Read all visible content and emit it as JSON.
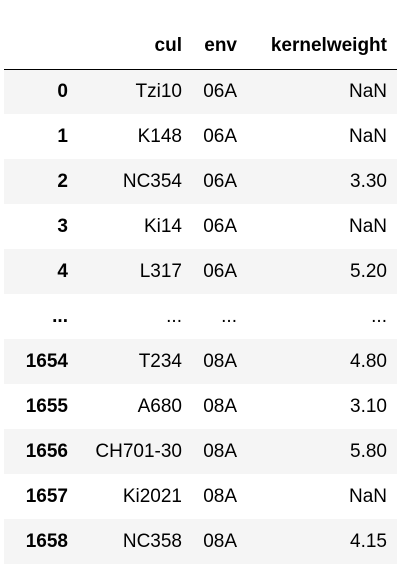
{
  "table": {
    "columns": [
      {
        "key": "index",
        "label": ""
      },
      {
        "key": "cul",
        "label": "cul"
      },
      {
        "key": "env",
        "label": "env"
      },
      {
        "key": "kernelweight",
        "label": "kernelweight"
      }
    ],
    "rows": [
      {
        "index": "0",
        "cul": "Tzi10",
        "env": "06A",
        "kernelweight": "NaN"
      },
      {
        "index": "1",
        "cul": "K148",
        "env": "06A",
        "kernelweight": "NaN"
      },
      {
        "index": "2",
        "cul": "NC354",
        "env": "06A",
        "kernelweight": "3.30"
      },
      {
        "index": "3",
        "cul": "Ki14",
        "env": "06A",
        "kernelweight": "NaN"
      },
      {
        "index": "4",
        "cul": "L317",
        "env": "06A",
        "kernelweight": "5.20"
      },
      {
        "index": "...",
        "cul": "...",
        "env": "...",
        "kernelweight": "..."
      },
      {
        "index": "1654",
        "cul": "T234",
        "env": "08A",
        "kernelweight": "4.80"
      },
      {
        "index": "1655",
        "cul": "A680",
        "env": "08A",
        "kernelweight": "3.10"
      },
      {
        "index": "1656",
        "cul": "CH701-30",
        "env": "08A",
        "kernelweight": "5.80"
      },
      {
        "index": "1657",
        "cul": "Ki2021",
        "env": "08A",
        "kernelweight": "NaN"
      },
      {
        "index": "1658",
        "cul": "NC358",
        "env": "08A",
        "kernelweight": "4.15"
      }
    ]
  }
}
